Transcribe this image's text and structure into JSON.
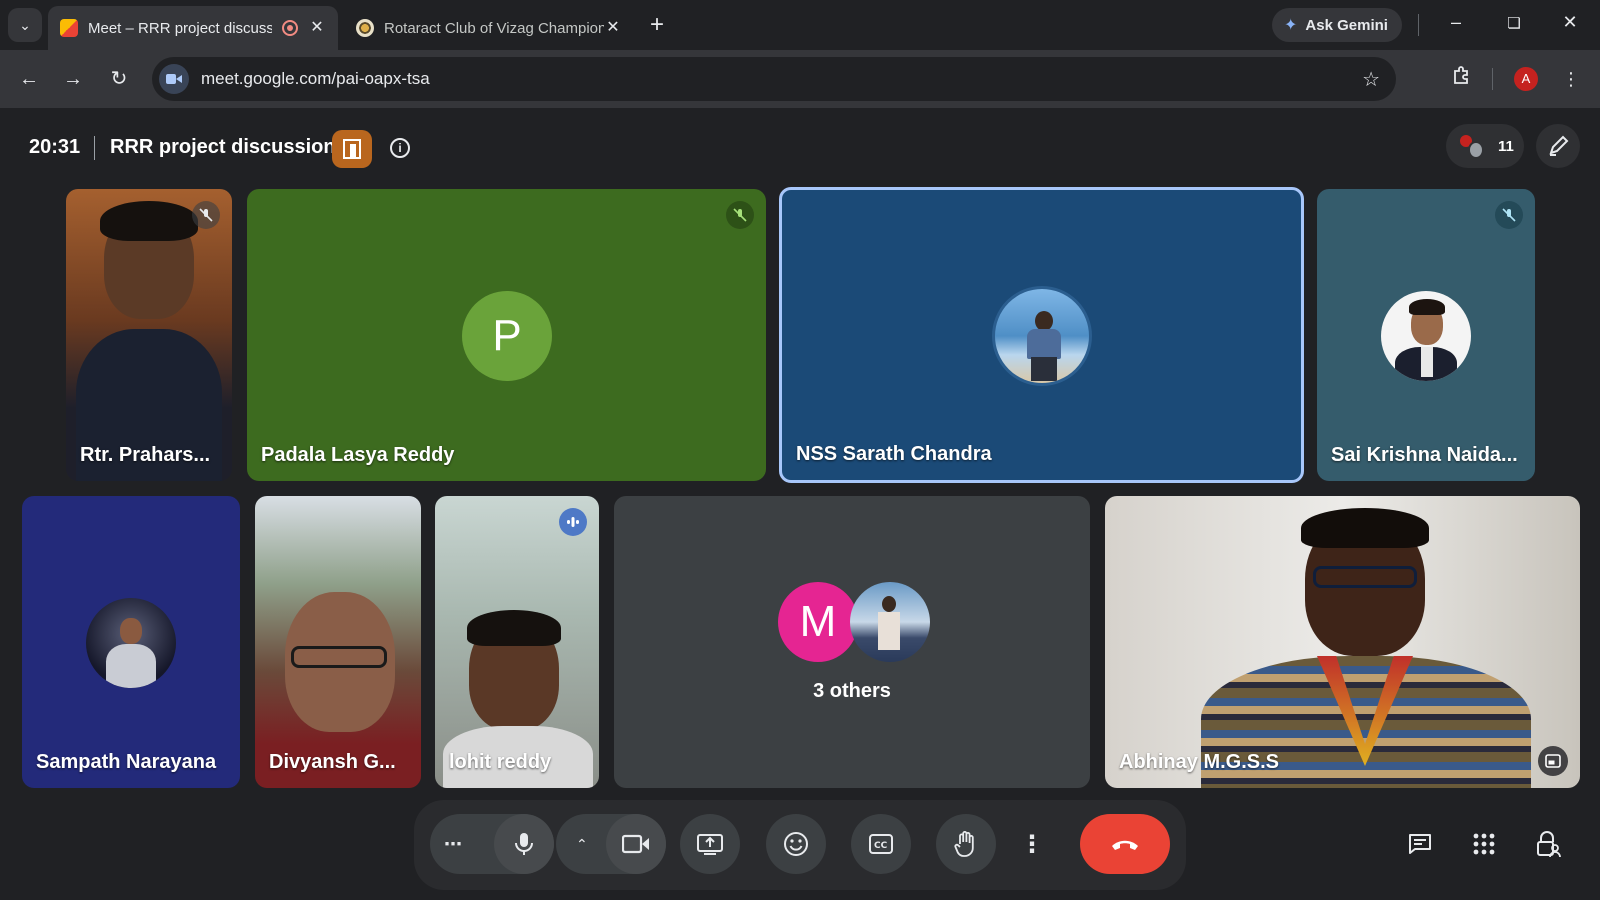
{
  "browser": {
    "tabs": [
      {
        "title": "Meet – RRR project discussion",
        "active": true
      },
      {
        "title": "Rotaract Club of Vizag Champions",
        "active": false
      }
    ],
    "new_tab": "+",
    "gemini_label": "Ask Gemini",
    "url": "meet.google.com/pai-oapx-tsa",
    "profile_initial": "A"
  },
  "meet": {
    "time": "20:31",
    "title": "RRR project discussion",
    "participant_count": "11",
    "tiles": [
      {
        "name": "Rtr. Prahars...",
        "muted": true
      },
      {
        "name": "Padala Lasya Reddy",
        "initial": "P",
        "muted": true
      },
      {
        "name": "NSS Sarath Chandra",
        "speaking": true
      },
      {
        "name": "Sai Krishna Naida...",
        "muted": true
      },
      {
        "name": "Sampath Narayana"
      },
      {
        "name": "Divyansh G..."
      },
      {
        "name": "lohit reddy",
        "speaking": true
      },
      {
        "name": "3 others",
        "initial": "M"
      },
      {
        "name": "Abhinay M.G.S.S"
      }
    ]
  },
  "colors": {
    "end_call": "#ea4335",
    "speaker_border": "#a8c7fa",
    "lasya_tile": "#3d6b1f",
    "sarath_tile": "#1b4a77",
    "sai_tile": "#355c6c",
    "sampath_tile": "#232a7a",
    "others_tile": "#3c4043"
  }
}
